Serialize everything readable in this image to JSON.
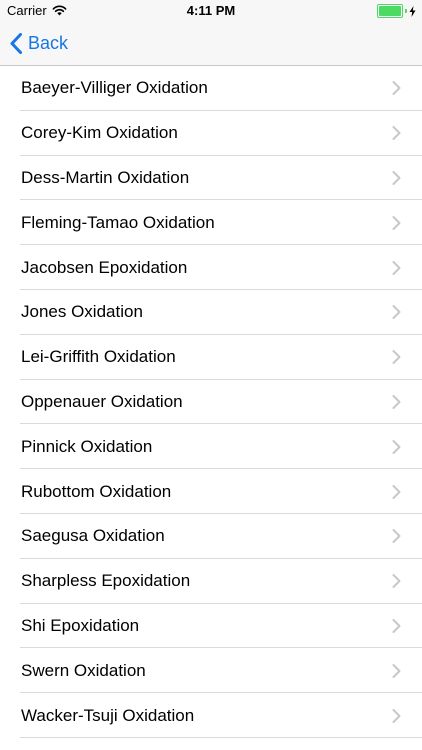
{
  "status_bar": {
    "carrier": "Carrier",
    "time": "4:11 PM",
    "battery_color": "#4cd964",
    "icons": [
      "wifi-icon",
      "battery-icon",
      "charging-bolt-icon"
    ]
  },
  "nav_bar": {
    "back_label": "Back",
    "accent_color": "#1676e6"
  },
  "list": {
    "items": [
      "Baeyer-Villiger Oxidation",
      "Corey-Kim Oxidation",
      "Dess-Martin Oxidation",
      "Fleming-Tamao Oxidation",
      "Jacobsen Epoxidation",
      "Jones Oxidation",
      "Lei-Griffith Oxidation",
      "Oppenauer Oxidation",
      "Pinnick Oxidation",
      "Rubottom Oxidation",
      "Saegusa Oxidation",
      "Sharpless Epoxidation",
      "Shi Epoxidation",
      "Swern Oxidation",
      "Wacker-Tsuji Oxidation"
    ],
    "row_icon": "chevron-right-icon"
  }
}
